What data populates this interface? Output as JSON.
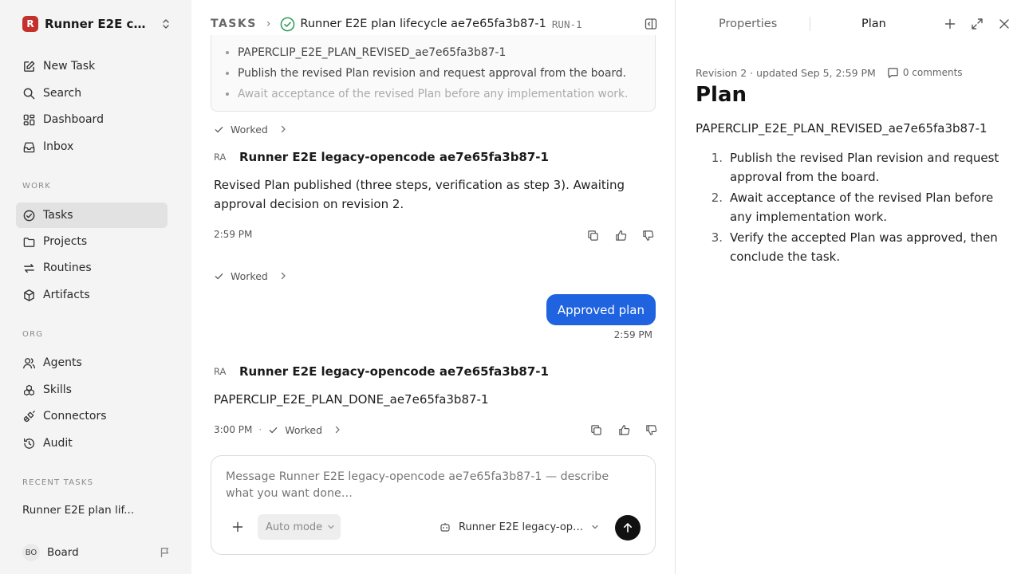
{
  "sidebar": {
    "workspace": {
      "logo_letter": "R",
      "name": "Runner E2E co...",
      "logo_color": "#c4302b"
    },
    "primary_nav": [
      {
        "label": "New Task",
        "icon": "new-task-icon"
      },
      {
        "label": "Search",
        "icon": "search-icon"
      },
      {
        "label": "Dashboard",
        "icon": "dashboard-icon"
      },
      {
        "label": "Inbox",
        "icon": "inbox-icon"
      }
    ],
    "work_label": "WORK",
    "work_nav": [
      {
        "label": "Tasks",
        "icon": "tasks-icon",
        "active": true
      },
      {
        "label": "Projects",
        "icon": "folder-icon"
      },
      {
        "label": "Routines",
        "icon": "routines-icon"
      },
      {
        "label": "Artifacts",
        "icon": "artifacts-icon"
      }
    ],
    "org_label": "ORG",
    "org_nav": [
      {
        "label": "Agents",
        "icon": "agents-icon"
      },
      {
        "label": "Skills",
        "icon": "skills-icon"
      },
      {
        "label": "Connectors",
        "icon": "connectors-icon"
      },
      {
        "label": "Audit",
        "icon": "audit-icon"
      }
    ],
    "recent_label": "RECENT TASKS",
    "recent_tasks": [
      "Runner E2E plan lif..."
    ],
    "user": {
      "initials": "BO",
      "name": "Board"
    }
  },
  "main": {
    "breadcrumb": {
      "section": "TASKS",
      "separator": "›",
      "title": "Runner E2E plan lifecycle ae7e65fa3b87-1",
      "run_id": "RUN-1"
    },
    "plan_preview_items": [
      "PAPERCLIP_E2E_PLAN_REVISED_ae7e65fa3b87-1",
      "Publish the revised Plan revision and request approval from the board.",
      "Await acceptance of the revised Plan before any implementation work."
    ],
    "worked_label": "Worked",
    "agent_initials": "RA",
    "agent_name": "Runner E2E legacy-opencode ae7e65fa3b87-1",
    "message_1": {
      "text": "Revised Plan published (three steps, verification as step 3). Awaiting approval decision on revision 2.",
      "time": "2:59 PM"
    },
    "user_message": {
      "text": "Approved plan",
      "time": "2:59 PM"
    },
    "message_2": {
      "text": "PAPERCLIP_E2E_PLAN_DONE_ae7e65fa3b87-1",
      "time": "3:00 PM"
    },
    "meta_sep": "·",
    "composer": {
      "placeholder": "Message Runner E2E legacy-opencode ae7e65fa3b87-1 — describe what you want done…",
      "mode": "Auto mode",
      "agent": "Runner E2E legacy-open..."
    },
    "accent_color": "#1f63e0",
    "status_color": "#2e9b57"
  },
  "right_panel": {
    "tabs": [
      "Properties",
      "Plan"
    ],
    "active_tab": "Plan",
    "revision_meta": "Revision 2 · updated Sep 5, 2:59 PM",
    "comments": "0 comments",
    "heading": "Plan",
    "token": "PAPERCLIP_E2E_PLAN_REVISED_ae7e65fa3b87-1",
    "steps": [
      {
        "num": "1.",
        "text": "Publish the revised Plan revision and request approval from the board."
      },
      {
        "num": "2.",
        "text": "Await acceptance of the revised Plan before any implementation work."
      },
      {
        "num": "3.",
        "text": "Verify the accepted Plan was approved, then conclude the task."
      }
    ]
  }
}
